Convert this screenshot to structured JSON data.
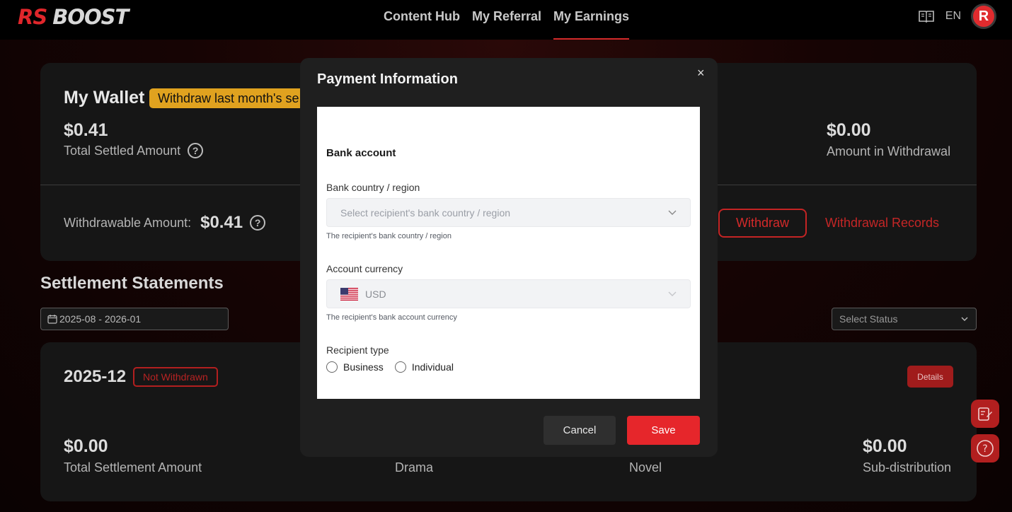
{
  "header": {
    "logo_rs": "RS",
    "logo_boost": "BOOST",
    "nav": [
      "Content Hub",
      "My Referral",
      "My Earnings"
    ],
    "active_nav": "My Earnings",
    "lang": "EN",
    "avatar_letter": "R",
    "accent_color": "#e0262b"
  },
  "wallet": {
    "title": "My Wallet",
    "badge": "Withdraw last month's se",
    "total_settled_value": "$0.41",
    "total_settled_label": "Total Settled Amount",
    "in_withdrawal_value": "$0.00",
    "in_withdrawal_label": "Amount in Withdrawal",
    "withdrawable_label": "Withdrawable Amount:",
    "withdrawable_value": "$0.41",
    "withdraw_button": "Withdraw",
    "records_link": "Withdrawal Records"
  },
  "statements": {
    "title": "Settlement Statements",
    "date_range": "2025-08 - 2026-01",
    "status_placeholder": "Select Status",
    "item": {
      "period": "2025-12",
      "status": "Not Withdrawn",
      "details_button": "Details",
      "total_value": "$0.00",
      "total_label": "Total Settlement Amount",
      "drama_label": "Drama",
      "novel_label": "Novel",
      "sub_value": "$0.00",
      "sub_label": "Sub-distribution"
    }
  },
  "modal": {
    "title": "Payment Information",
    "close": "×",
    "section_heading": "Bank account",
    "country_label": "Bank country / region",
    "country_placeholder": "Select recipient's bank country / region",
    "country_help": "The recipient's bank country / region",
    "currency_label": "Account currency",
    "currency_value": "USD",
    "currency_help": "The recipient's bank account currency",
    "recipient_label": "Recipient type",
    "recipient_options": [
      "Business",
      "Individual"
    ],
    "cancel_button": "Cancel",
    "save_button": "Save"
  },
  "floating": {
    "feedback_icon": "edit-note-icon",
    "help_icon": "help-icon"
  }
}
